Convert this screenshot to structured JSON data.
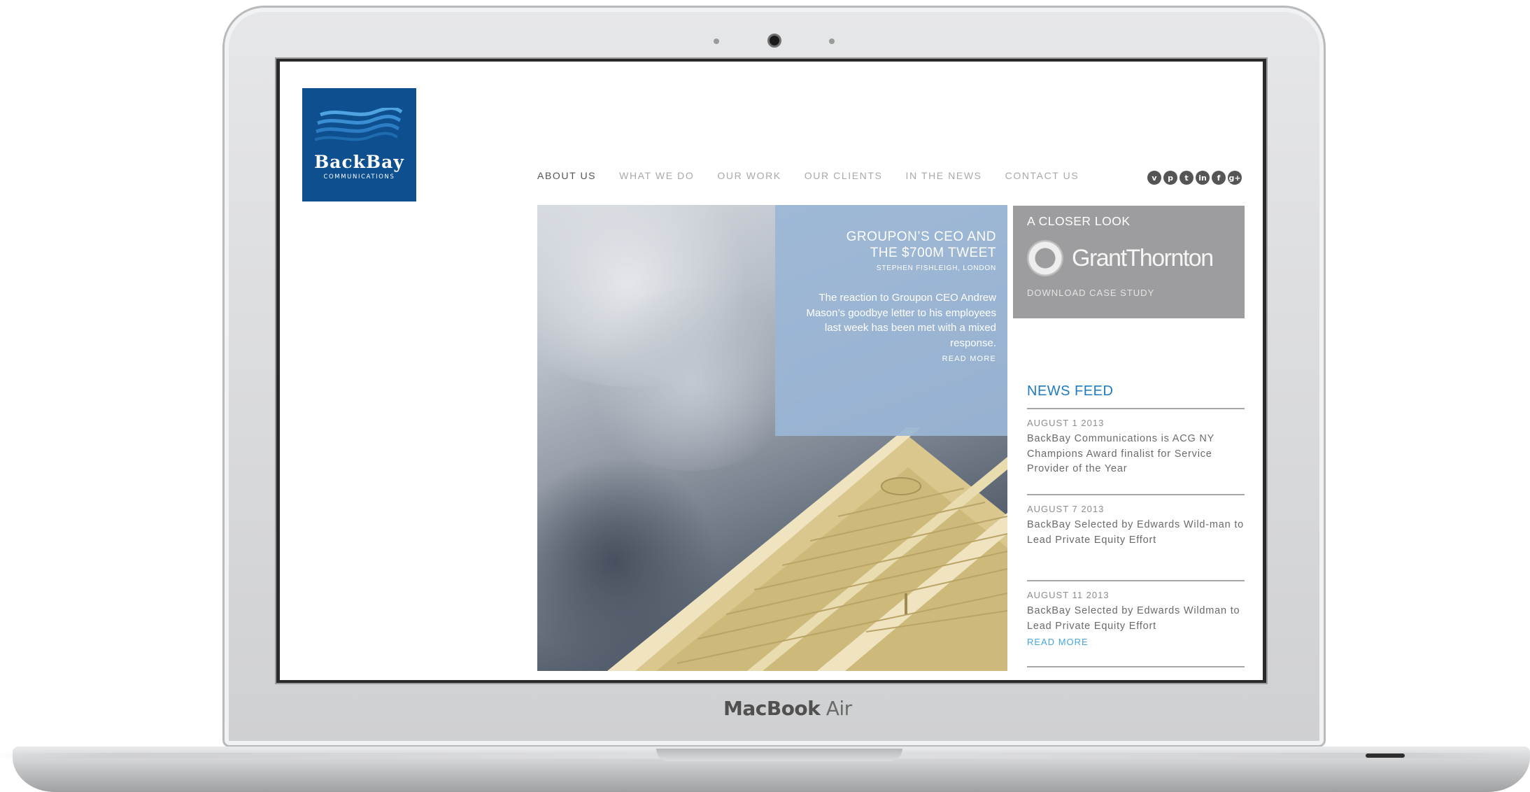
{
  "device": {
    "model_strong": "MacBook",
    "model_light": "Air"
  },
  "site": {
    "logo": {
      "name": "BackBay",
      "sub": "COMMUNICATIONS"
    },
    "nav": [
      {
        "label": "ABOUT US",
        "active": true
      },
      {
        "label": "WHAT WE DO",
        "active": false
      },
      {
        "label": "OUR WORK",
        "active": false
      },
      {
        "label": "OUR CLIENTS",
        "active": false
      },
      {
        "label": "IN THE NEWS",
        "active": false
      },
      {
        "label": "CONTACT US",
        "active": false
      }
    ],
    "social_icons": [
      "vimeo-icon",
      "pinterest-icon",
      "twitter-icon",
      "linkedin-icon",
      "facebook-icon",
      "google-plus-icon"
    ],
    "hero": {
      "title_line1": "GROUPON’S CEO AND",
      "title_line2": "THE $700M TWEET",
      "byline": "STEPHEN FISHLEIGH, LONDON",
      "body": "The reaction to Groupon CEO Andrew Mason’s goodbye letter to his employees last week has been met with a mixed response.",
      "read_more": "READ MORE"
    },
    "closer_look": {
      "title": "A CLOSER LOOK",
      "brand": "GrantThornton",
      "download": "DOWNLOAD CASE STUDY"
    },
    "news_feed": {
      "title": "NEWS FEED",
      "items": [
        {
          "date": "AUGUST 1 2013",
          "text": "BackBay Communications is ACG NY Champions Award finalist for Service Provider of the Year"
        },
        {
          "date": "AUGUST 7 2013",
          "text": "BackBay Selected by Edwards Wild-man to Lead Private Equity Effort"
        },
        {
          "date": "AUGUST 11 2013",
          "text": "BackBay Selected by Edwards Wildman to Lead Private Equity Effort"
        }
      ],
      "read_more": "READ MORE"
    },
    "colors": {
      "logo_blue": "#0d4f8f",
      "feed_title": "#1f7bc2",
      "link": "#46a7d9",
      "panel_gray": "#9d9d9f"
    }
  }
}
